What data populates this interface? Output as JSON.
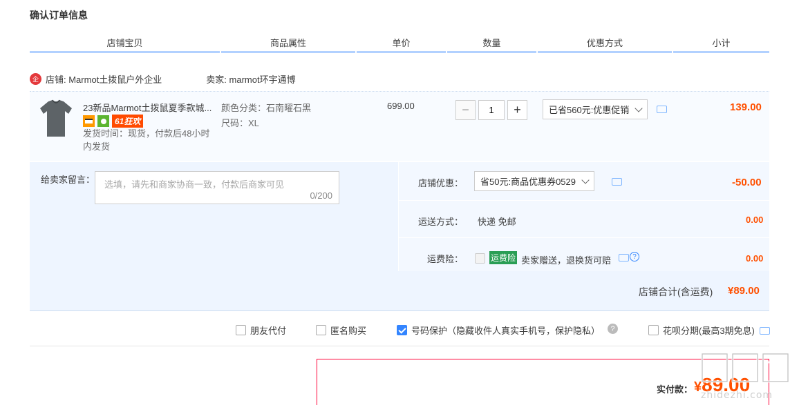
{
  "title": "确认订单信息",
  "columns": [
    "店铺宝贝",
    "商品属性",
    "单价",
    "数量",
    "优惠方式",
    "小计"
  ],
  "shop": {
    "icon_text": "企",
    "label": "店铺: Marmot土拨鼠户外企业",
    "seller": "卖家: marmot环宇通博"
  },
  "item": {
    "name": "23新品Marmot土拨鼠夏季款城...",
    "badge_61": "61狂欢",
    "ship_time": "发货时间：现货，付款后48小时内发货",
    "attr_color": "颜色分类：石南曜石黑",
    "attr_size": "尺码：XL",
    "unit_price": "699.00",
    "quantity": "1",
    "minus": "−",
    "plus": "+",
    "promo": "已省560元:优惠促销",
    "subtotal": "139.00"
  },
  "message": {
    "label": "给卖家留言：",
    "placeholder": "选填，请先和商家协商一致，付款后商家可见",
    "counter": "0/200"
  },
  "shop_discount": {
    "label": "店铺优惠：",
    "value": "省50元:商品优惠券0529",
    "amount": "-50.00"
  },
  "shipping": {
    "label": "运送方式：",
    "value": "快递 免邮",
    "amount": "0.00"
  },
  "insurance": {
    "label": "运费险：",
    "badge": "运费险",
    "desc": "卖家赠送，退换货可赔",
    "amount": "0.00"
  },
  "shop_total": {
    "label": "店铺合计(含运费)",
    "amount": "¥89.00"
  },
  "options": {
    "friend_pay": "朋友代付",
    "anonymous": "匿名购买",
    "number_protect": "号码保护（隐藏收件人真实手机号，保护隐私）",
    "huabei": "花呗分期(最高3期免息)"
  },
  "payment": {
    "label": "实付款：",
    "currency": "¥",
    "amount": "89.00"
  },
  "watermark": "什么值得买",
  "colors": {
    "accent_orange": "#ff5000",
    "header_line": "#b2d1ff",
    "bg_blue": "#eef5ff",
    "check_blue": "#3385ff"
  }
}
